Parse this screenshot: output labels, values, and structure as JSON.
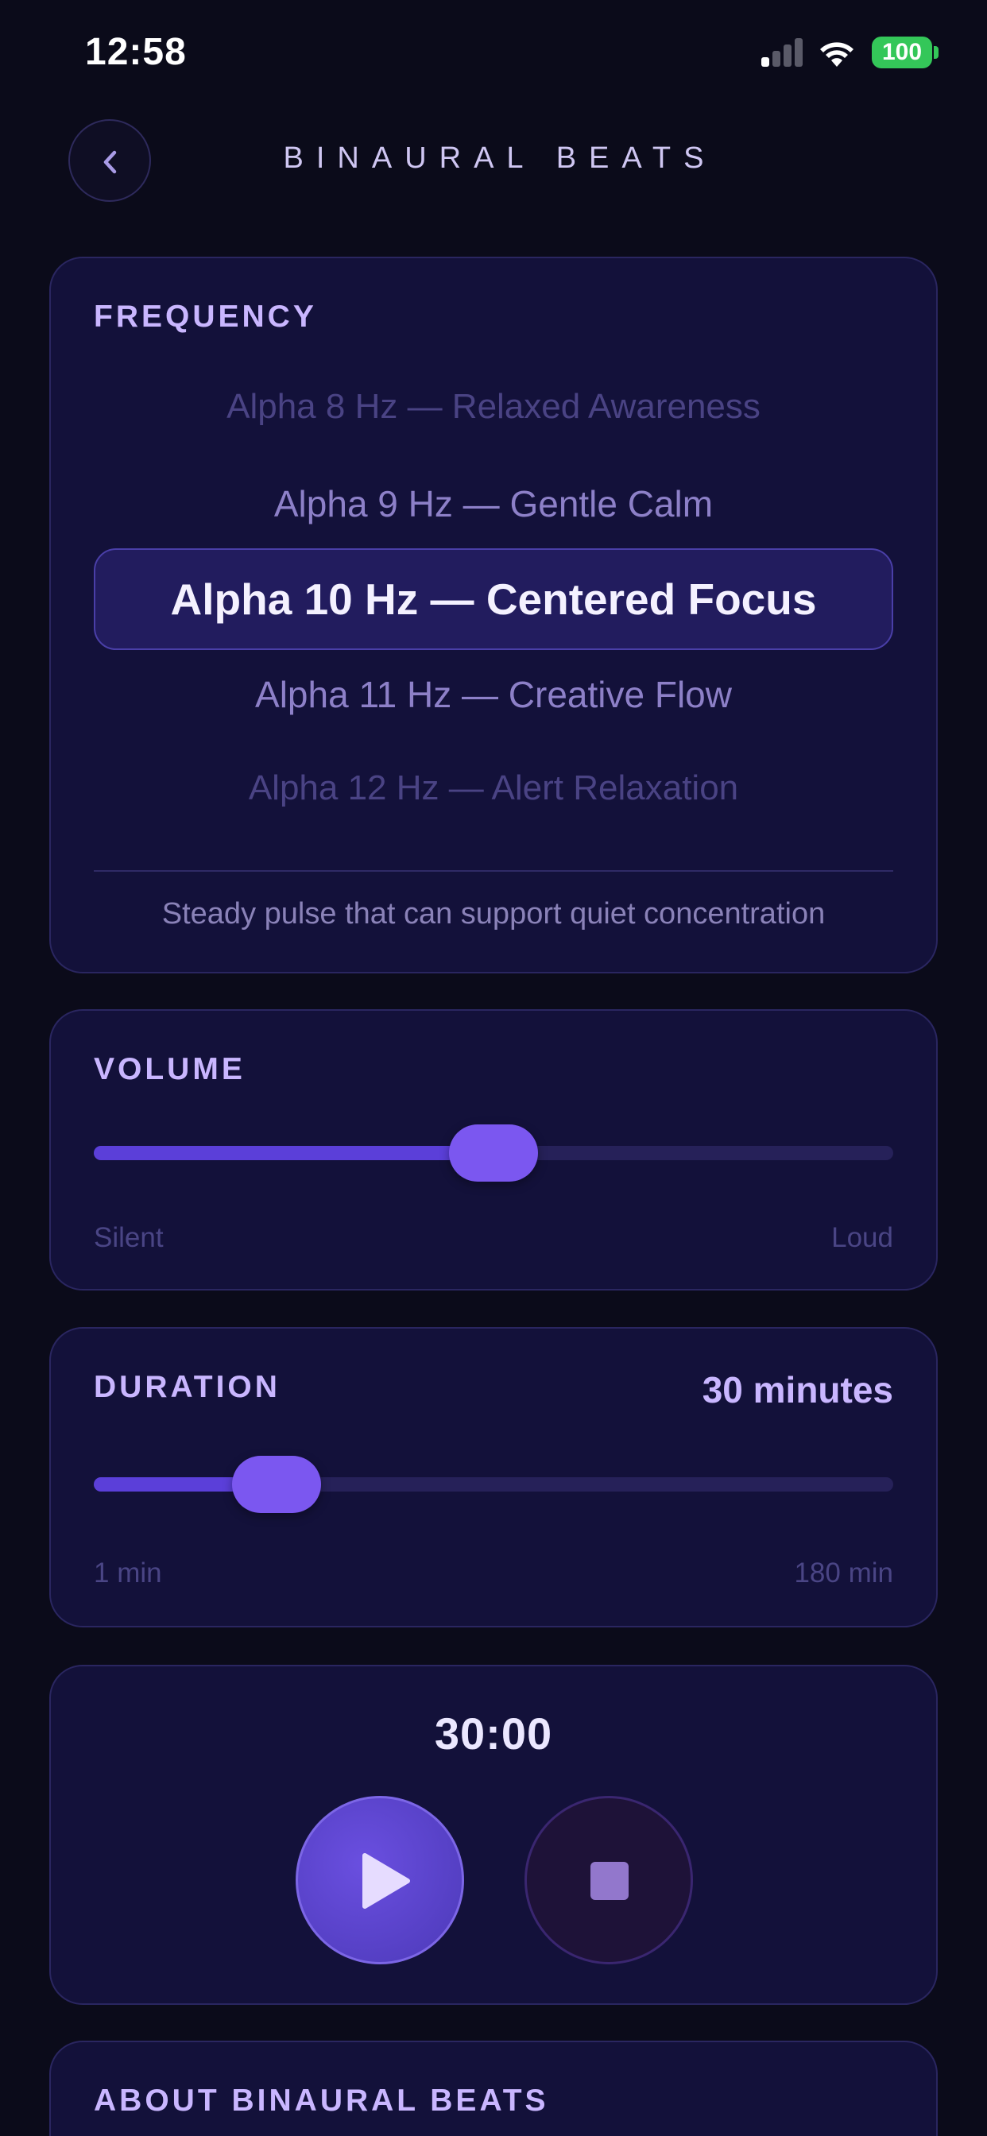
{
  "status_bar": {
    "time": "12:58",
    "battery": "100"
  },
  "nav": {
    "title": "BINAURAL BEATS"
  },
  "frequency": {
    "label": "FREQUENCY",
    "options": [
      "Alpha 8 Hz — Relaxed Awareness",
      "Alpha 9 Hz — Gentle Calm",
      "Alpha 10 Hz — Centered Focus",
      "Alpha 11 Hz — Creative Flow",
      "Alpha 12 Hz — Alert Relaxation"
    ],
    "selected_index": 2,
    "description": "Steady pulse that can support quiet concentration"
  },
  "volume": {
    "label": "VOLUME",
    "level_fraction": 0.5,
    "min_label": "Silent",
    "max_label": "Loud"
  },
  "duration": {
    "label": "DURATION",
    "value_label": "30 minutes",
    "value_minutes": 30,
    "min_minutes": 1,
    "max_minutes": 180,
    "min_label": "1 min",
    "max_label": "180 min"
  },
  "player": {
    "timer": "30:00"
  },
  "about": {
    "label": "ABOUT BINAURAL BEATS"
  },
  "colors": {
    "accent": "#7b57f0",
    "card": "#13113a",
    "background": "#0b0b1a"
  }
}
